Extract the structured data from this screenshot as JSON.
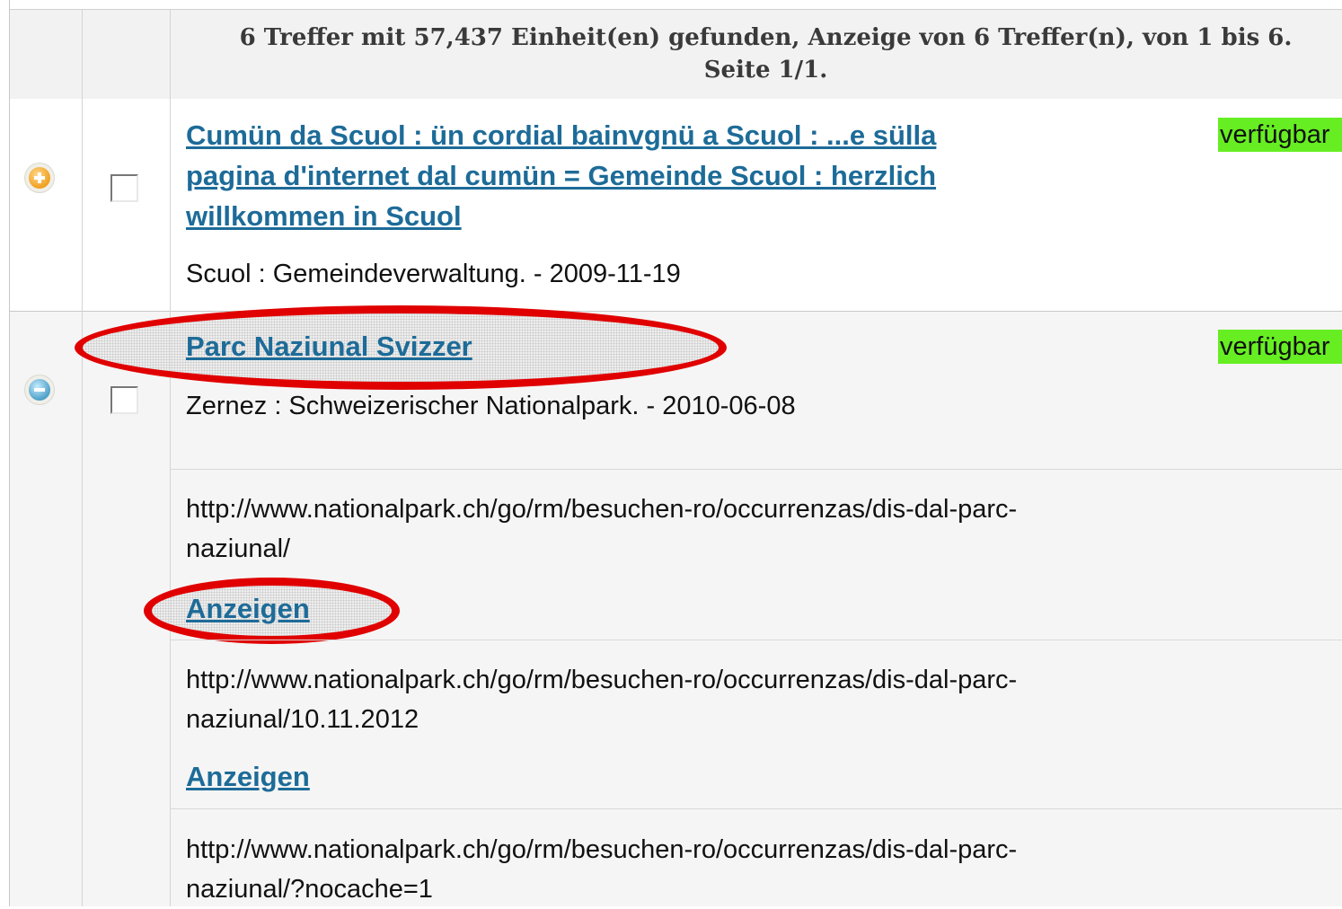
{
  "header": {
    "summary_line1": "6 Treffer mit 57,437 Einheit(en) gefunden, Anzeige von 6 Treffer(n), von 1 bis 6.",
    "summary_line2": "Seite 1/1."
  },
  "results": [
    {
      "expand_icon": "plus-icon",
      "title_line1": "Cumün da Scuol : ün cordial bainvgnü a Scuol : ...e sülla",
      "title_line2": "pagina d'internet dal cumün = Gemeinde Scuol : herzlich",
      "title_line3": "willkommen in Scuol",
      "imprint": "Scuol : Gemeindeverwaltung. - 2009-11-19",
      "availability": "verfügbar"
    },
    {
      "expand_icon": "minus-icon",
      "title": "Parc Naziunal Svizzer",
      "imprint": "Zernez : Schweizerischer Nationalpark. - 2010-06-08",
      "availability": "verfügbar",
      "links": [
        {
          "url_line1": "http://www.nationalpark.ch/go/rm/besuchen-ro/occurrenzas/dis-dal-parc-",
          "url_line2": "naziunal/",
          "action": "Anzeigen"
        },
        {
          "url_line1": "http://www.nationalpark.ch/go/rm/besuchen-ro/occurrenzas/dis-dal-parc-",
          "url_line2": "naziunal/10.11.2012",
          "action": "Anzeigen"
        },
        {
          "url_line1": "http://www.nationalpark.ch/go/rm/besuchen-ro/occurrenzas/dis-dal-parc-",
          "url_line2": "naziunal/?nocache=1"
        }
      ]
    }
  ],
  "colors": {
    "link": "#1d6b98",
    "available_bg": "#66ee22",
    "annotation_red": "#e00000"
  }
}
